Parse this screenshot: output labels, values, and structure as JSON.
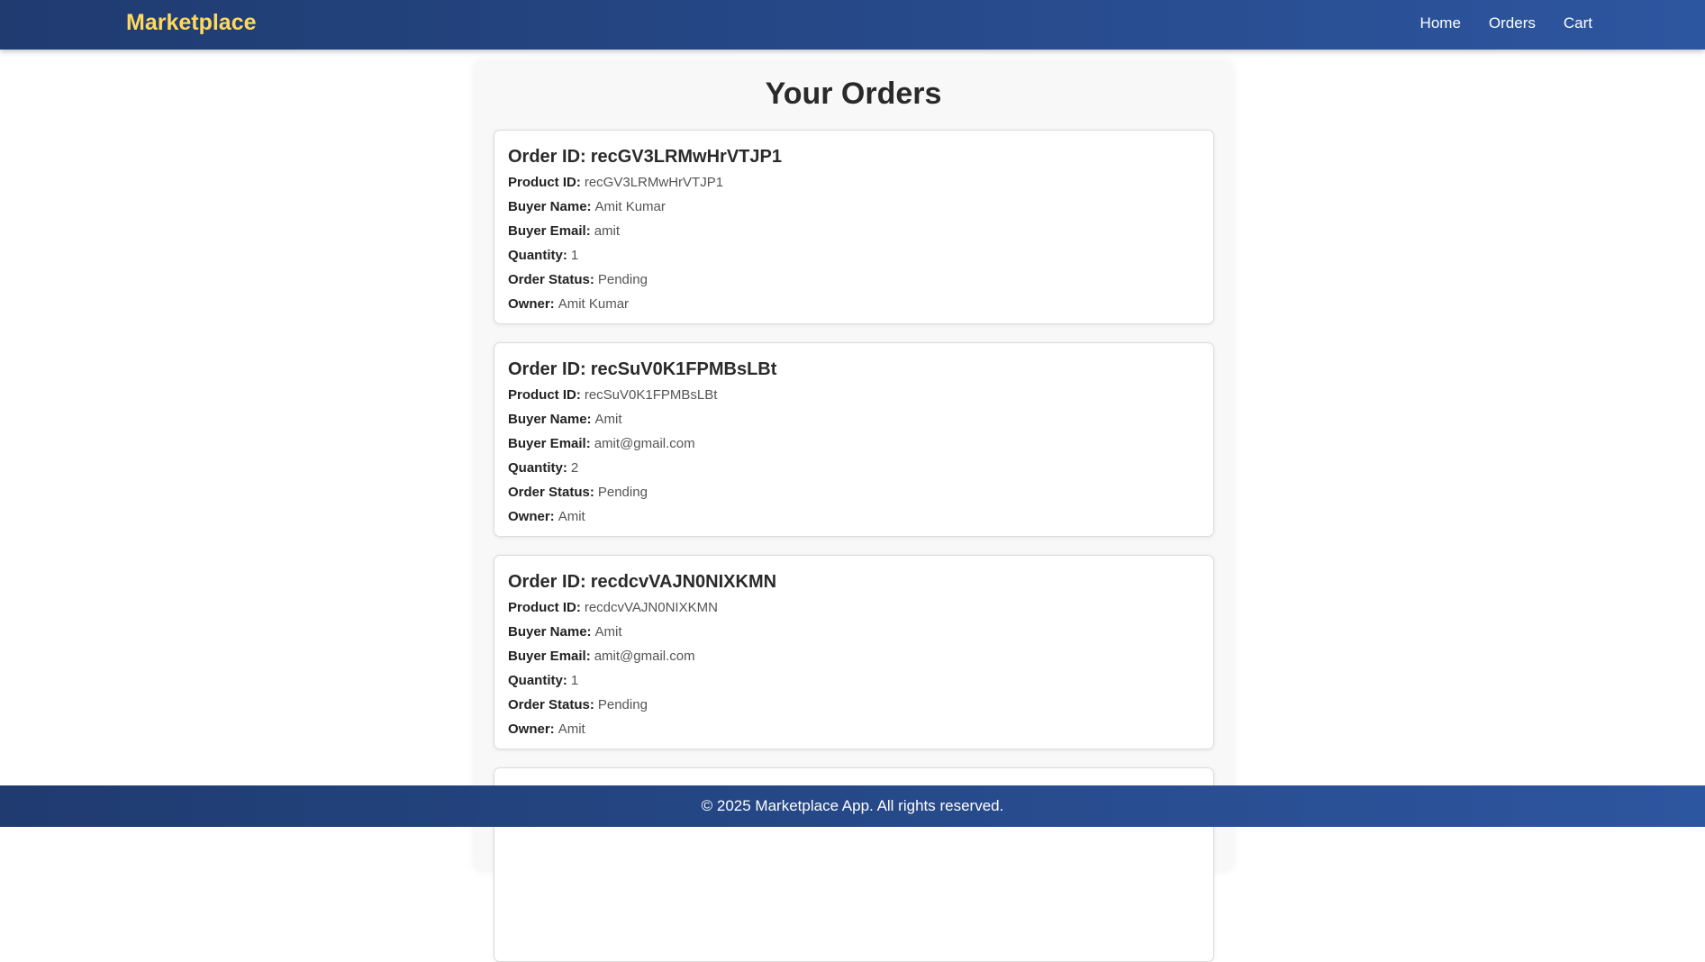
{
  "header": {
    "brand": "Marketplace",
    "nav": [
      "Home",
      "Orders",
      "Cart"
    ]
  },
  "page": {
    "title": "Your Orders"
  },
  "labels": {
    "order_id": "Order ID:",
    "product_id": "Product ID:",
    "buyer_name": "Buyer Name:",
    "buyer_email": "Buyer Email:",
    "quantity": "Quantity:",
    "order_status": "Order Status:",
    "owner": "Owner:"
  },
  "orders": [
    {
      "order_id": "recGV3LRMwHrVTJP1",
      "product_id": "recGV3LRMwHrVTJP1",
      "buyer_name": "Amit Kumar",
      "buyer_email": "amit",
      "quantity": "1",
      "order_status": "Pending",
      "owner": "Amit Kumar"
    },
    {
      "order_id": "recSuV0K1FPMBsLBt",
      "product_id": "recSuV0K1FPMBsLBt",
      "buyer_name": "Amit",
      "buyer_email": "amit@gmail.com",
      "quantity": "2",
      "order_status": "Pending",
      "owner": "Amit"
    },
    {
      "order_id": "recdcvVAJN0NIXKMN",
      "product_id": "recdcvVAJN0NIXKMN",
      "buyer_name": "Amit",
      "buyer_email": "amit@gmail.com",
      "quantity": "1",
      "order_status": "Pending",
      "owner": "Amit"
    }
  ],
  "footer": {
    "text": "© 2025 Marketplace App. All rights reserved."
  },
  "colors": {
    "nav_gradient_start": "#1f3b70",
    "nav_gradient_end": "#2d56a0",
    "brand": "#ffd95a"
  }
}
